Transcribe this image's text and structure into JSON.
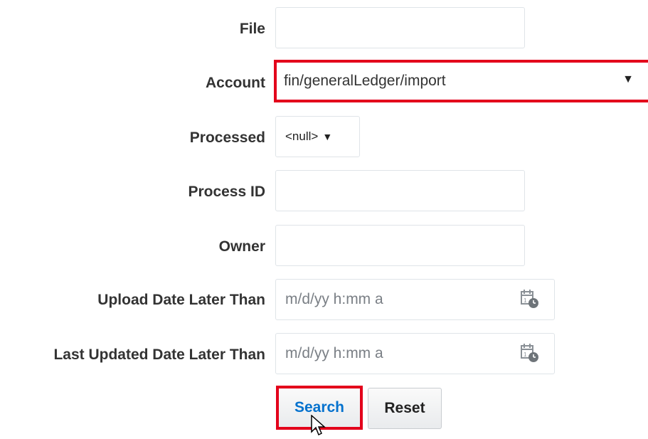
{
  "labels": {
    "file": "File",
    "account": "Account",
    "processed": "Processed",
    "process_id": "Process ID",
    "owner": "Owner",
    "upload_date": "Upload Date Later Than",
    "last_updated_date": "Last Updated Date Later Than"
  },
  "fields": {
    "file_value": "",
    "account_value": "fin/generalLedger/import",
    "processed_value": "<null>",
    "process_id_value": "",
    "owner_value": "",
    "upload_date_placeholder": "m/d/yy h:mm a",
    "last_updated_placeholder": "m/d/yy h:mm a"
  },
  "icons": {
    "dropdown": "▼",
    "calendar": "calendar-clock-icon"
  },
  "buttons": {
    "search": "Search",
    "reset": "Reset"
  },
  "colors": {
    "highlight": "#e3001b",
    "search_text": "#0572ce"
  }
}
